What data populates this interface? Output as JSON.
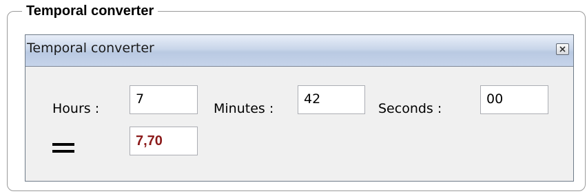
{
  "group": {
    "title": "Temporal converter"
  },
  "window": {
    "title": "Temporal converter"
  },
  "fields": {
    "hours_label": "Hours :",
    "hours_value": "7",
    "minutes_label": "Minutes :",
    "minutes_value": "42",
    "seconds_label": "Seconds :",
    "seconds_value": "00",
    "equals_symbol": "=",
    "result_value": "7,70"
  },
  "colors": {
    "result_text": "#8b1a1a",
    "titlebar": "#c6d4ea"
  },
  "icons": {
    "close": "close-icon"
  }
}
